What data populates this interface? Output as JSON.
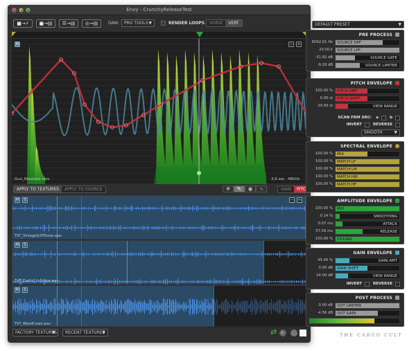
{
  "window": {
    "title": "Envy - CrunchyReleaseTest",
    "traffic_lights": [
      "close",
      "minimize",
      "zoom"
    ]
  },
  "toolbar": {
    "buttons": [
      {
        "icon": "track-to-plug-icon",
        "label": "■→⚡"
      },
      {
        "icon": "track-to-track-icon",
        "label": "■→▤"
      },
      {
        "icon": "list-to-track-icon",
        "label": "☰→▤"
      },
      {
        "icon": "record-to-track-icon",
        "label": "◎→▤"
      }
    ],
    "daw_label": "DAW:",
    "daw_value": "PRO TOOLS",
    "render_loops_label": "RENDER LOOPS",
    "orientation": {
      "options": [
        "HORIZ",
        "VERT"
      ],
      "selected": "VERT"
    }
  },
  "preset": {
    "value": "DEFAULT PRESET"
  },
  "envelope_view": {
    "file_name": "Gun_Ratatata.wav",
    "duration": "3.6 sec",
    "sample_rate": "48kHz",
    "zoom_out": "−",
    "zoom_in": "+",
    "mute_icon_label": "M"
  },
  "midbar": {
    "apply_tabs": [
      "APPLY TO TEXTURES",
      "APPLY TO SOURCE"
    ],
    "apply_selected": "APPLY TO TEXTURES",
    "tools": [
      "bug-icon",
      "pencil-icon",
      "brush-icon",
      "wave-icon"
    ],
    "tool_selected": "pencil-icon",
    "mode_tabs": [
      "GAIN",
      "PITCH"
    ],
    "mode_selected": "PITCH"
  },
  "tracks": [
    {
      "name": "TXT_VintageSciFiTones.wav",
      "mute": "M",
      "solo": "S"
    },
    {
      "name": "TXT_ExoticCrisScape.wav",
      "mute": "M",
      "solo": "S"
    },
    {
      "name": "TXT_WoodCreak.wav",
      "mute": "M",
      "solo": "S"
    }
  ],
  "bottombar": {
    "factory_textures": "FACTORY TEXTURES",
    "recent_textures": "RECENT TEXTURES"
  },
  "panels": {
    "pre_process": {
      "title": "PRE PROCESS",
      "rows": [
        {
          "value": "6092.01 Hz",
          "label": "SOURCE HPF",
          "fill": 0.74
        },
        {
          "value": "20.00 k",
          "label": "SOURCE LPF",
          "fill": 1.0
        },
        {
          "value": "-31.82 dB",
          "label": "SOURCE GATE",
          "fill": 0.3
        },
        {
          "value": "-9.20 dB",
          "label": "SOURCE LIMITER",
          "fill": 0.38
        }
      ]
    },
    "pitch_envelope": {
      "title": "PITCH ENVELOPE",
      "rows": [
        {
          "value": "100.00 %",
          "label": "PITCH AMT",
          "fill": 0.5
        },
        {
          "value": "0.00 st",
          "label": "PITCH SHIFT",
          "fill": 0.5
        },
        {
          "value": "24.00 st",
          "label": "VIEW RANGE",
          "fill": 0.2
        }
      ],
      "scan_label": "SCAN FRM SRC:",
      "a_label": "a",
      "b_label": "b",
      "invert_label": "INVERT",
      "reverse_label": "REVERSE",
      "smoothing_mode": "SMOOTH"
    },
    "spectral_envelope": {
      "title": "SPECTRAL ENVELOPE",
      "rows": [
        {
          "value": "100.00 %",
          "label": "MIX",
          "fill": 0.5
        },
        {
          "value": "100.00 %",
          "label": "MATCH LF",
          "fill": 1.0
        },
        {
          "value": "100.00 %",
          "label": "MATCH LM",
          "fill": 1.0
        },
        {
          "value": "100.00 %",
          "label": "MATCH HM",
          "fill": 1.0
        },
        {
          "value": "100.00 %",
          "label": "MATCH HF",
          "fill": 1.0
        }
      ]
    },
    "amplitude_envelope": {
      "title": "AMPLITUDE ENVELOPE",
      "rows": [
        {
          "value": "100.00 %",
          "label": "MIX",
          "fill": 1.0
        },
        {
          "value": "0.14 %",
          "label": "SMOOTHING",
          "fill": 0.07
        },
        {
          "value": "0.07 ms",
          "label": "ATTACK",
          "fill": 0.11
        },
        {
          "value": "57.59 ms",
          "label": "RELEASE",
          "fill": 0.42
        },
        {
          "value": "100.00 %",
          "label": "CEILING",
          "fill": 1.0
        }
      ]
    },
    "gain_envelope": {
      "title": "GAIN ENVELOPE",
      "rows": [
        {
          "value": "45.46 %",
          "label": "GAIN AMT",
          "fill": 0.22
        },
        {
          "value": "0.00 dB",
          "label": "GAIN SHIFT",
          "fill": 0.5
        },
        {
          "value": "24.00 dB",
          "label": "VIEW RANGE",
          "fill": 0.2
        }
      ],
      "invert_label": "INVERT",
      "reverse_label": "REVERSE"
    },
    "post_process": {
      "title": "POST PROCESS",
      "rows": [
        {
          "value": "0.00 dB",
          "label": "OUT LIMITER",
          "fill": 1.0
        },
        {
          "value": "-4.56 dB",
          "label": "OUT GAIN",
          "fill": 0.66
        }
      ],
      "meter_level": 0.72
    }
  },
  "brand": "THE CARGO CULT",
  "colors": {
    "pitch": "#c8303c",
    "spectral": "#b5a33c",
    "amplitude": "#2aa63a",
    "gain": "#4aa8c0",
    "neutral": "#9a9a9a",
    "track": "#2a4a66",
    "waveform": "#4a8ee0"
  }
}
